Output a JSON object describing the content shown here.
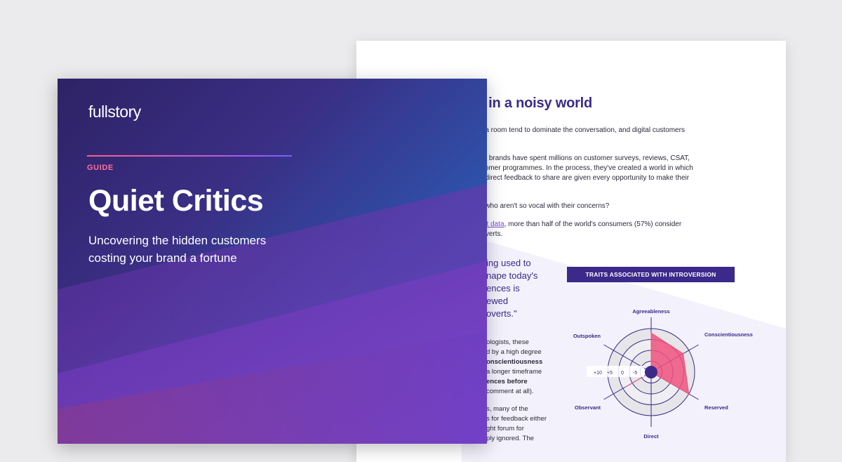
{
  "document": {
    "heading": "ces in a noisy world",
    "intro_lines": [
      "n a room tend to dominate the conversation, and digital customers",
      "ne brands have spent millions on customer surveys, reviews, CSAT,",
      "stomer programmes. In the process, they've created a world in which",
      "h direct feedback to share are given every opportunity to make their",
      "e who aren't so vocal with their concerns?"
    ],
    "stat_link": "est data",
    "stat_rest": ", more than half of the world's consumers (57%) consider",
    "stat_line2": "roverts.",
    "quote_lines": [
      "ing used to",
      "nape today's",
      "ences is",
      "ewed",
      "overts.\""
    ],
    "body_lines": [
      "ologists, these",
      "d by a high degree",
      "onscientiousness",
      "a longer timeframe",
      "ences before",
      "comment at all).",
      "s, many of the",
      "s for feedback either",
      "ght forum for",
      "ply ignored. The"
    ]
  },
  "chart_data": {
    "type": "radar",
    "title": "TRAITS ASSOCIATED WITH INTROVERSION",
    "axes": [
      "Agreeableness",
      "Conscientiousness",
      "Reserved",
      "Direct",
      "Observant",
      "Outspoken"
    ],
    "scale_labels": [
      "+10",
      "+5",
      "0",
      "-5"
    ],
    "rlim": [
      -10,
      10
    ],
    "series": [
      {
        "values": [
          8,
          7,
          10,
          -10,
          4,
          -10
        ],
        "color": "#f0517e"
      }
    ],
    "center_color": "#3b2a8a",
    "ring_fill": "#e6e6e9",
    "ring_stroke": "#3b2a8a"
  },
  "cover": {
    "logo": "fullstory",
    "kicker": "GUIDE",
    "title": "Quiet Critics",
    "subtitle_line1": "Uncovering the hidden customers",
    "subtitle_line2": "costing your brand a fortune"
  },
  "colors": {
    "accent_pink": "#ff6f9c",
    "brand_purple": "#3b2a8a",
    "cover_blue": "#2168c8"
  }
}
